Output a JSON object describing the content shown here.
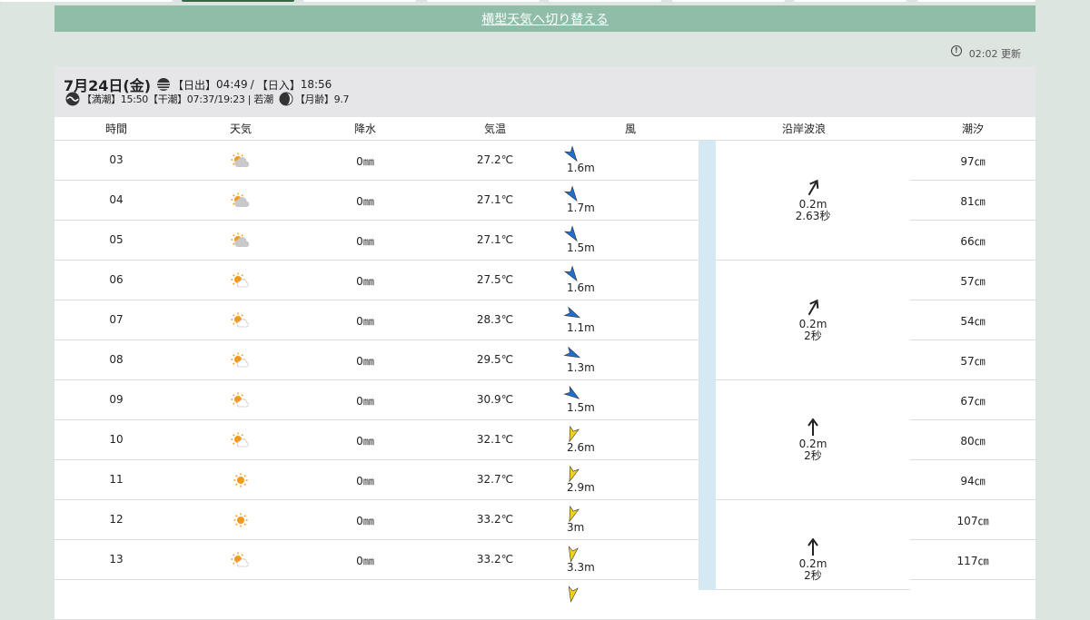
{
  "header": {
    "switch_label": "横型天気へ切り替える",
    "updated": "02:02 更新"
  },
  "day": {
    "date": "7月24日(金)",
    "sunrise_label": "【日出】",
    "sunrise": "04:49",
    "sep": "/",
    "sunset_label": "【日入】",
    "sunset": "18:56",
    "tide_text": "【満潮】15:50【干潮】07:37/19:23 | 若潮",
    "moon_label": "【月齢】",
    "moon_age": "9.7"
  },
  "columns": {
    "time": "時間",
    "weather": "天気",
    "precip": "降水",
    "temp": "気温",
    "wind": "風",
    "wave": "沿岸波浪",
    "tide": "潮汐"
  },
  "rows": [
    {
      "time": "03",
      "weather_icon": "partly-cloudy-icon",
      "precip": "0㎜",
      "temp": "27.2℃",
      "wind_speed": "1.6m",
      "wind_color": "#1f6fd1",
      "wind_angle": 145,
      "tide": "97㎝"
    },
    {
      "time": "04",
      "weather_icon": "partly-cloudy-icon",
      "precip": "0㎜",
      "temp": "27.1℃",
      "wind_speed": "1.7m",
      "wind_color": "#1f6fd1",
      "wind_angle": 145,
      "tide": "81㎝"
    },
    {
      "time": "05",
      "weather_icon": "partly-cloudy-icon",
      "precip": "0㎜",
      "temp": "27.1℃",
      "wind_speed": "1.5m",
      "wind_color": "#1f6fd1",
      "wind_angle": 145,
      "tide": "66㎝"
    },
    {
      "time": "06",
      "weather_icon": "sun-cloud-icon",
      "precip": "0㎜",
      "temp": "27.5℃",
      "wind_speed": "1.6m",
      "wind_color": "#1f6fd1",
      "wind_angle": 145,
      "tide": "57㎝"
    },
    {
      "time": "07",
      "weather_icon": "sun-cloud-icon",
      "precip": "0㎜",
      "temp": "28.3℃",
      "wind_speed": "1.1m",
      "wind_color": "#1f6fd1",
      "wind_angle": 115,
      "tide": "54㎝"
    },
    {
      "time": "08",
      "weather_icon": "sun-cloud-icon",
      "precip": "0㎜",
      "temp": "29.5℃",
      "wind_speed": "1.3m",
      "wind_color": "#1f6fd1",
      "wind_angle": 115,
      "tide": "57㎝"
    },
    {
      "time": "09",
      "weather_icon": "sun-cloud-icon",
      "precip": "0㎜",
      "temp": "30.9℃",
      "wind_speed": "1.5m",
      "wind_color": "#1f6fd1",
      "wind_angle": 125,
      "tide": "67㎝"
    },
    {
      "time": "10",
      "weather_icon": "sun-cloud-icon",
      "precip": "0㎜",
      "temp": "32.1℃",
      "wind_speed": "2.6m",
      "wind_color": "#f2d21b",
      "wind_angle": 200,
      "tide": "80㎝"
    },
    {
      "time": "11",
      "weather_icon": "sun-icon",
      "precip": "0㎜",
      "temp": "32.7℃",
      "wind_speed": "2.9m",
      "wind_color": "#f2d21b",
      "wind_angle": 200,
      "tide": "94㎝"
    },
    {
      "time": "12",
      "weather_icon": "sun-icon",
      "precip": "0㎜",
      "temp": "33.2℃",
      "wind_speed": "3m",
      "wind_color": "#f2d21b",
      "wind_angle": 200,
      "tide": "107㎝"
    },
    {
      "time": "13",
      "weather_icon": "sun-cloud-icon",
      "precip": "0㎜",
      "temp": "33.2℃",
      "wind_speed": "3.3m",
      "wind_color": "#f2d21b",
      "wind_angle": 190,
      "tide": "117㎝"
    },
    {
      "time": "",
      "weather_icon": "",
      "precip": "",
      "temp": "",
      "wind_speed": "",
      "wind_color": "#f2d21b",
      "wind_angle": 190,
      "tide": ""
    }
  ],
  "waves": [
    {
      "height": "0.2m",
      "period": "2.63秒",
      "angle": 30
    },
    {
      "height": "0.2m",
      "period": "2秒",
      "angle": 30
    },
    {
      "height": "0.2m",
      "period": "2秒",
      "angle": 0
    },
    {
      "height": "0.2m",
      "period": "2秒",
      "angle": 0
    }
  ],
  "colors": {
    "background": "#dde5e1",
    "switch_bar": "#8fbda7",
    "wind_north": "#1f6fd1",
    "wind_south": "#f2d21b",
    "wave_strip": "#d4e9f3"
  }
}
